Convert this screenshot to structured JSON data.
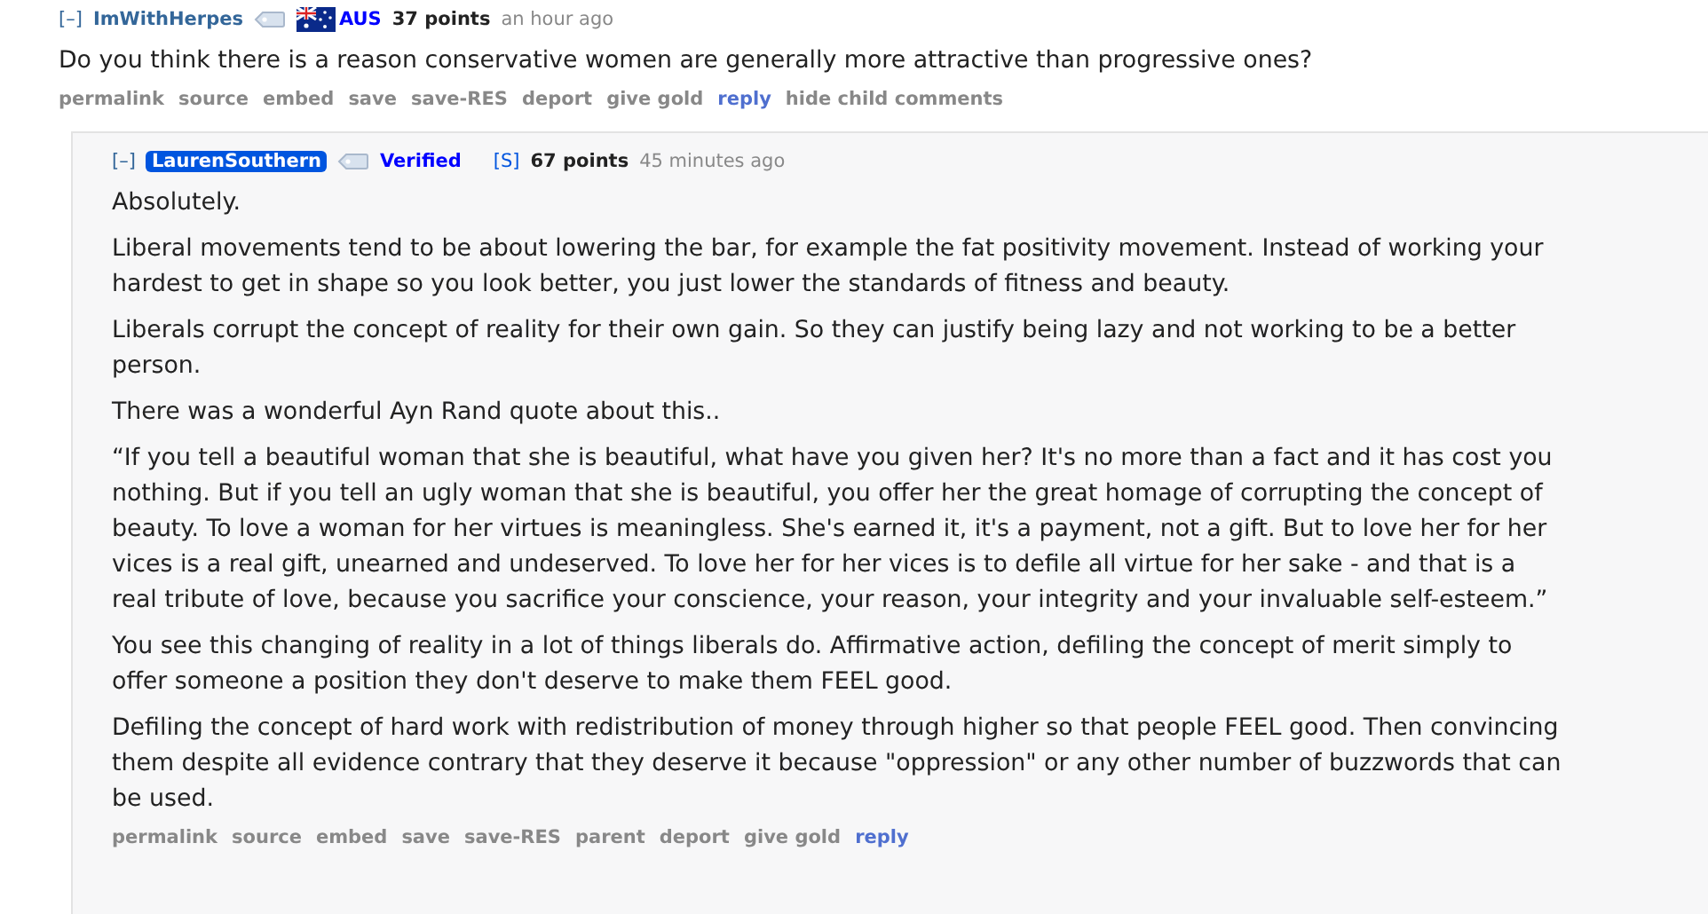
{
  "comments": [
    {
      "collapse": "[–]",
      "author": "ImWithHerpes",
      "author_highlighted": false,
      "flair": {
        "text": "AUS",
        "kind": "flag"
      },
      "points": "37 points",
      "time": "an hour ago",
      "paragraphs": [
        "Do you think there is a reason conservative women are generally more attractive than progressive ones?"
      ],
      "links": [
        {
          "label": "permalink",
          "kind": "plain"
        },
        {
          "label": "source",
          "kind": "plain"
        },
        {
          "label": "embed",
          "kind": "plain"
        },
        {
          "label": "save",
          "kind": "plain"
        },
        {
          "label": "save-RES",
          "kind": "plain"
        },
        {
          "label": "deport",
          "kind": "plain"
        },
        {
          "label": "give gold",
          "kind": "plain"
        },
        {
          "label": "reply",
          "kind": "primary"
        },
        {
          "label": "hide child comments",
          "kind": "plain"
        }
      ]
    },
    {
      "collapse": "[–]",
      "author": "LaurenSouthern",
      "author_highlighted": true,
      "flair": {
        "text": "Verified",
        "kind": "text"
      },
      "submitter": "[S]",
      "points": "67 points",
      "time": "45 minutes ago",
      "paragraphs": [
        "Absolutely.",
        "Liberal movements tend to be about lowering the bar, for example the fat positivity movement. Instead of working your hardest to get in shape so you look better, you just lower the standards of fitness and beauty.",
        "Liberals corrupt the concept of reality for their own gain. So they can justify being lazy and not working to be a better person.",
        "There was a wonderful Ayn Rand quote about this..",
        "“If you tell a beautiful woman that she is beautiful, what have you given her? It's no more than a fact and it has cost you nothing. But if you tell an ugly woman that she is beautiful, you offer her the great homage of corrupting the concept of beauty. To love a woman for her virtues is meaningless. She's earned it, it's a payment, not a gift. But to love her for her vices is a real gift, unearned and undeserved. To love her for her vices is to defile all virtue for her sake - and that is a real tribute of love, because you sacrifice your conscience, your reason, your integrity and your invaluable self-esteem.”",
        "You see this changing of reality in a lot of things liberals do. Affirmative action, defiling the concept of merit simply to offer someone a position they don't deserve to make them FEEL good.",
        "Defiling the concept of hard work with redistribution of money through higher so that people FEEL good. Then convincing them despite all evidence contrary that they deserve it because \"oppression\" or any other number of buzzwords that can be used."
      ],
      "links": [
        {
          "label": "permalink",
          "kind": "plain"
        },
        {
          "label": "source",
          "kind": "plain"
        },
        {
          "label": "embed",
          "kind": "plain"
        },
        {
          "label": "save",
          "kind": "plain"
        },
        {
          "label": "save-RES",
          "kind": "plain"
        },
        {
          "label": "parent",
          "kind": "plain"
        },
        {
          "label": "deport",
          "kind": "plain"
        },
        {
          "label": "give gold",
          "kind": "plain"
        },
        {
          "label": "reply",
          "kind": "primary"
        }
      ]
    }
  ]
}
